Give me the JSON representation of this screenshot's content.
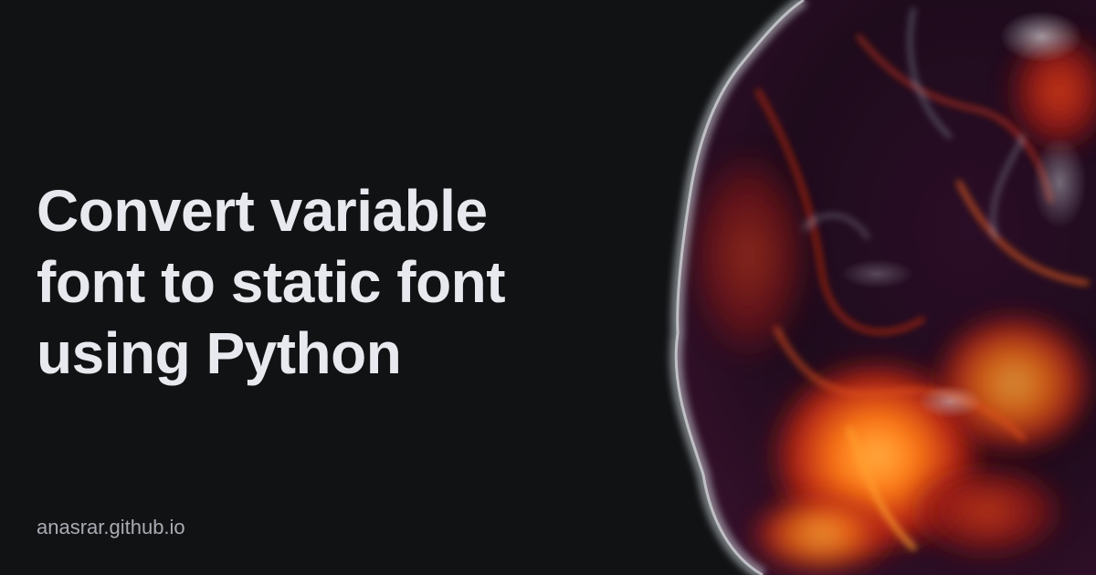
{
  "title": {
    "lines": [
      "Convert variable",
      "font to static font",
      "using Python"
    ]
  },
  "site": {
    "url": "anasrar.github.io"
  },
  "colors": {
    "background": "#111214",
    "title": "#e8e9ee",
    "site": "#a9abb3",
    "blob_dark": "#1e0b1c",
    "blob_red": "#b21f12",
    "blob_orange": "#ff7a14",
    "blob_rim": "#cfd6dc"
  },
  "art": {
    "icon": "abstract-liquid-blob"
  }
}
